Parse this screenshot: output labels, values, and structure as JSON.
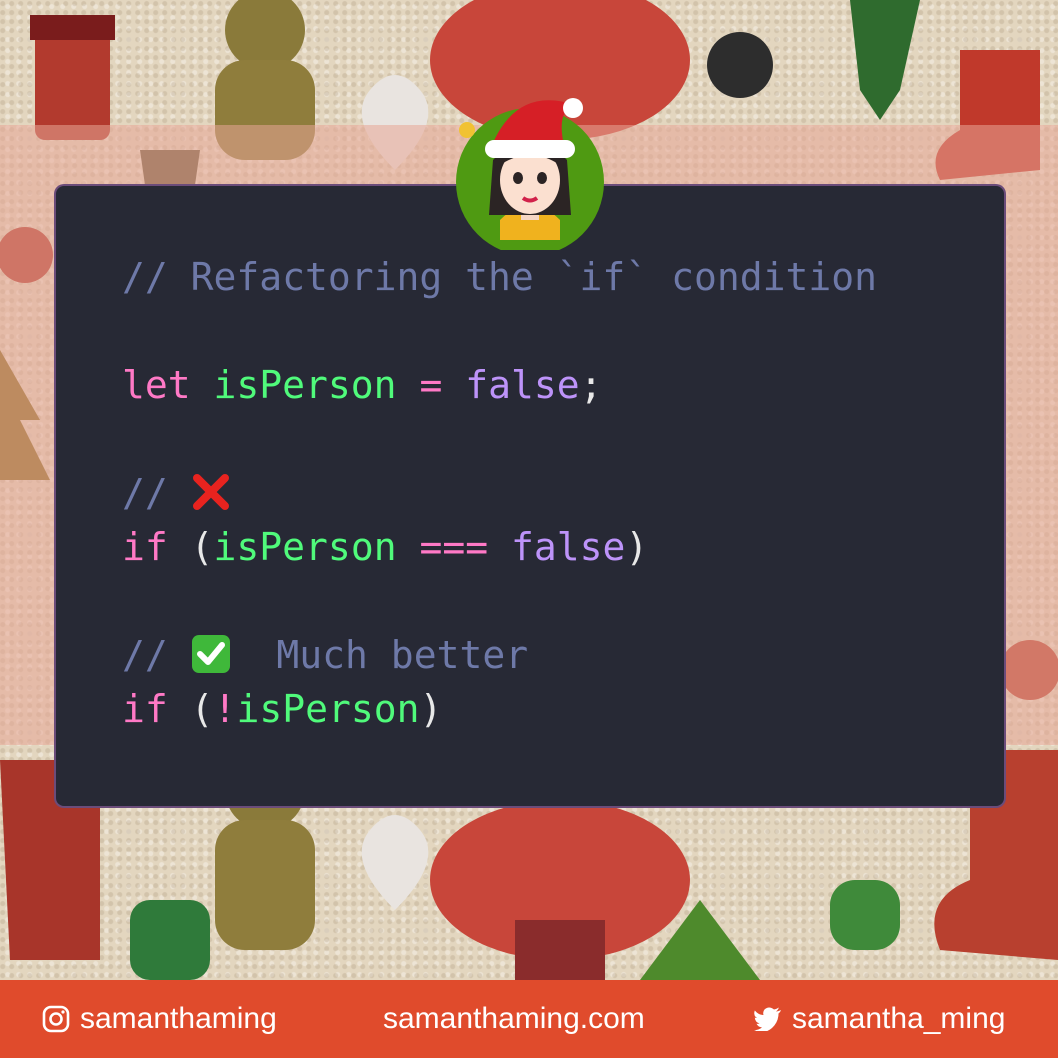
{
  "code": {
    "comment1": "// Refactoring the `if` condition",
    "line_let": {
      "kw": "let",
      "var": "isPerson",
      "op": "=",
      "val": "false",
      "end": ";"
    },
    "comment2": "//",
    "line_if1": {
      "kw": "if",
      "open": "(",
      "var": "isPerson",
      "op": "===",
      "val": "false",
      "close": ")"
    },
    "comment3_prefix": "//",
    "comment3_text": "Much better",
    "line_if2": {
      "kw": "if",
      "open": "(",
      "op": "!",
      "var": "isPerson",
      "close": ")"
    }
  },
  "icons": {
    "cross": "cross-mark-icon",
    "check": "check-mark-icon",
    "instagram": "instagram-icon",
    "twitter": "twitter-icon",
    "avatar": "avatar-santa-hat"
  },
  "footer": {
    "instagram": "samanthaming",
    "website": "samanthaming.com",
    "twitter": "samantha_ming"
  },
  "colors": {
    "footer_bg": "#e04b2c",
    "card_bg": "#272935",
    "avatar_bg": "#4f9a12"
  }
}
